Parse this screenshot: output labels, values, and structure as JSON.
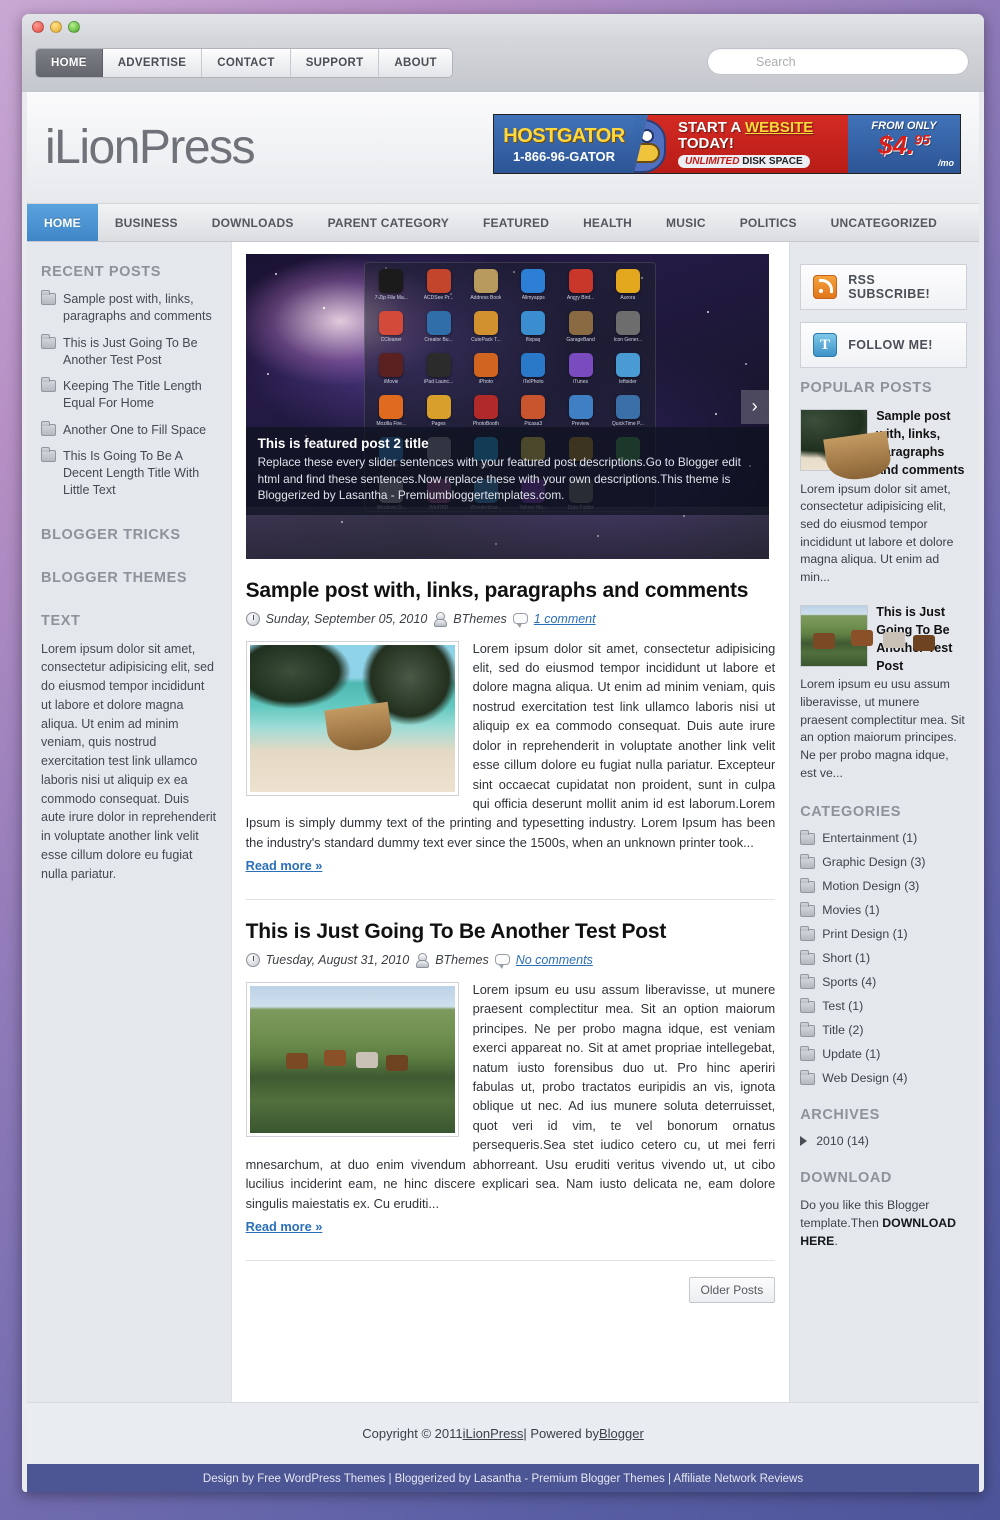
{
  "browser": {
    "dots": [
      "close",
      "minimize",
      "zoom"
    ]
  },
  "topnav": {
    "items": [
      {
        "label": "HOME",
        "active": true
      },
      {
        "label": "ADVERTISE",
        "active": false
      },
      {
        "label": "CONTACT",
        "active": false
      },
      {
        "label": "SUPPORT",
        "active": false
      },
      {
        "label": "ABOUT",
        "active": false
      }
    ]
  },
  "search": {
    "placeholder": "Search",
    "value": ""
  },
  "header": {
    "logo_first": "i",
    "logo_rest": "LionPress",
    "logo_full": "iLionPress"
  },
  "banner": {
    "brand": "HOSTGATOR",
    "phone": "1-866-96-GATOR",
    "headline_pre": "START A ",
    "headline_em": "WEBSITE",
    "headline_post": "TODAY!",
    "subline_em": "UNLIMITED",
    "subline_rest": " DISK SPACE",
    "price_label": "FROM ONLY",
    "price_main": "$4.",
    "price_cents": "95",
    "price_unit": "/mo"
  },
  "mainnav": {
    "items": [
      {
        "label": "HOME",
        "active": true
      },
      {
        "label": "BUSINESS",
        "active": false
      },
      {
        "label": "DOWNLOADS",
        "active": false
      },
      {
        "label": "PARENT CATEGORY",
        "active": false
      },
      {
        "label": "FEATURED",
        "active": false
      },
      {
        "label": "HEALTH",
        "active": false
      },
      {
        "label": "MUSIC",
        "active": false
      },
      {
        "label": "POLITICS",
        "active": false
      },
      {
        "label": "UNCATEGORIZED",
        "active": false
      }
    ]
  },
  "sidebar_left": {
    "recent_posts_title": "RECENT POSTS",
    "recent_posts": [
      "Sample post with, links, paragraphs and comments",
      "This is Just Going To Be Another Test Post",
      "Keeping The Title Length Equal For Home",
      "Another One to Fill Space",
      "This Is Going To Be A Decent Length Title With Little Text"
    ],
    "blogger_tricks_title": "BLOGGER TRICKS",
    "blogger_themes_title": "BLOGGER THEMES",
    "text_title": "TEXT",
    "text_body": "Lorem ipsum dolor sit amet, consectetur adipisicing elit, sed do eiusmod tempor incididunt ut labore et dolore magna aliqua. Ut enim ad minim veniam, quis nostrud exercitation test link ullamco laboris nisi ut aliquip ex ea commodo consequat. Duis aute irure dolor in reprehenderit in voluptate another link velit esse cillum dolore eu fugiat nulla pariatur."
  },
  "slider": {
    "caption_title": "This is featured post 2 title",
    "caption_body": "Replace these every slider sentences with your featured post descriptions.Go to Blogger edit html and find these sentences.Now replace these with your own descriptions.This theme is Bloggerized by Lasantha - Premiumbloggertemplates.com.",
    "next_arrow": "›",
    "apps": [
      {
        "name": "7-Zip File Ma...",
        "color": "#1b1b1b"
      },
      {
        "name": "ACDSee Pr...",
        "color": "#c3452c"
      },
      {
        "name": "Address Book",
        "color": "#b99a5e"
      },
      {
        "name": "Allmyapps",
        "color": "#2c7fd4"
      },
      {
        "name": "Angry Bird...",
        "color": "#c9372b"
      },
      {
        "name": "Aurora",
        "color": "#e4a81f"
      },
      {
        "name": "CCleaner",
        "color": "#d34a3a"
      },
      {
        "name": "Creator Bu...",
        "color": "#2f6ea8"
      },
      {
        "name": "CutePack T...",
        "color": "#d2912f"
      },
      {
        "name": "flixpaq",
        "color": "#3a8ecf"
      },
      {
        "name": "GarageBand",
        "color": "#8a6a42"
      },
      {
        "name": "Icon Gener...",
        "color": "#6d6d6d"
      },
      {
        "name": "iMovie",
        "color": "#5b2020"
      },
      {
        "name": "iPad Launc...",
        "color": "#2b2b2b"
      },
      {
        "name": "iPhoto",
        "color": "#d1641f"
      },
      {
        "name": "iTelPhoto",
        "color": "#2a79c8"
      },
      {
        "name": "iTunes",
        "color": "#7a4bbf"
      },
      {
        "name": "leftsider",
        "color": "#4a9ad4"
      },
      {
        "name": "Mozilla Fire...",
        "color": "#e06b1e"
      },
      {
        "name": "Pages",
        "color": "#d8a02a"
      },
      {
        "name": "PhotoBooth",
        "color": "#b02a2a"
      },
      {
        "name": "Picasa3",
        "color": "#c8552e"
      },
      {
        "name": "Preview",
        "color": "#3f7fc4"
      },
      {
        "name": "QuickTime P...",
        "color": "#3b6fa8"
      },
      {
        "name": "Safari",
        "color": "#2f86cc"
      },
      {
        "name": "Settings",
        "color": "#8d9199"
      },
      {
        "name": "Skype",
        "color": "#22a4e0"
      },
      {
        "name": "Sticky Notes",
        "color": "#e8d14a"
      },
      {
        "name": "Total Imag...",
        "color": "#b58a2a"
      },
      {
        "name": "uTorrent",
        "color": "#3e9c4c"
      },
      {
        "name": "Windows D...",
        "color": "#9aa0a8"
      },
      {
        "name": "WinRAR",
        "color": "#9c4b8a"
      },
      {
        "name": "Wondershar...",
        "color": "#3d8fc8"
      },
      {
        "name": "Yahoo! Me...",
        "color": "#7b3fb5"
      },
      {
        "name": "Data Folder",
        "color": "#6f6f6f"
      }
    ]
  },
  "posts": [
    {
      "title": "Sample post with, links, paragraphs and comments",
      "date": "Sunday, September 05, 2010",
      "author": "BThemes",
      "comments": "1 comment",
      "body": "Lorem ipsum dolor sit amet, consectetur adipisicing elit, sed do eiusmod tempor incididunt ut labore et dolore magna aliqua. Ut enim ad minim veniam, quis nostrud exercitation test link ullamco laboris nisi ut aliquip ex ea commodo consequat. Duis aute irure dolor in reprehenderit in voluptate another link velit esse cillum dolore eu fugiat nulla pariatur. Excepteur sint occaecat cupidatat non proident, sunt in culpa qui officia deserunt mollit anim id est laborum.Lorem Ipsum is simply dummy text of the printing and typesetting industry. Lorem Ipsum has been the industry's standard dummy text ever since the 1500s, when an unknown printer took...",
      "readmore": "Read more »",
      "thumb": "beach-longtail-boat"
    },
    {
      "title": "This is Just Going To Be Another Test Post",
      "date": "Tuesday, August 31, 2010",
      "author": "BThemes",
      "comments": "No comments",
      "body": "Lorem ipsum eu usu assum liberavisse, ut munere praesent complectitur mea. Sit an option maiorum principes. Ne per probo magna idque, est veniam exerci appareat no. Sit at amet propriae intellegebat, natum iusto forensibus duo ut. Pro hinc aperiri fabulas ut, probo tractatos euripidis an vis, ignota oblique ut nec. Ad ius munere soluta deterruisset, quot veri id vim, te vel bonorum ornatus persequeris.Sea stet iudico cetero cu, ut mei ferri mnesarchum, at duo enim vivendum abhorreant. Usu eruditi veritus vivendo ut, ut cibo lucilius inciderint eam, ne hinc discere explicari sea. Nam iusto delicata ne, eam dolore singulis maiestatis ex. Cu eruditi...",
      "readmore": "Read more »",
      "thumb": "horses-field"
    }
  ],
  "pager": {
    "older_posts": "Older Posts"
  },
  "sidebar_right": {
    "rss_label": "RSS SUBSCRIBE!",
    "follow_label": "FOLLOW ME!",
    "popular_title": "POPULAR POSTS",
    "popular_posts": [
      {
        "title": "Sample post with, links, paragraphs and comments",
        "excerpt": "Lorem ipsum dolor sit amet, consectetur adipisicing elit, sed do eiusmod tempor incididunt ut labore et dolore magna aliqua. Ut enim ad min...",
        "thumb": "beach-longtail-boat"
      },
      {
        "title": "This is Just Going To Be Another Test Post",
        "excerpt": "Lorem ipsum eu usu assum liberavisse, ut munere praesent complectitur mea. Sit an option maiorum principes. Ne per probo magna idque, est ve...",
        "thumb": "horses-field"
      }
    ],
    "categories_title": "CATEGORIES",
    "categories": [
      "Entertainment (1)",
      "Graphic Design (3)",
      "Motion Design (3)",
      "Movies (1)",
      "Print Design (1)",
      "Short (1)",
      "Sports (4)",
      "Test (1)",
      "Title (2)",
      "Update (1)",
      "Web Design (4)"
    ],
    "archives_title": "ARCHIVES",
    "archive_entry": "2010 (14)",
    "download_title": "DOWNLOAD",
    "download_text_pre": "Do you like this Blogger template.Then ",
    "download_text_link": "DOWNLOAD HERE",
    "download_text_post": "."
  },
  "footer": {
    "copyright_pre": "Copyright © 2011 ",
    "copyright_site": "iLionPress",
    "copyright_mid": " | Powered by ",
    "copyright_platform": "Blogger",
    "credit": "Design by Free WordPress Themes | Bloggerized by Lasantha - Premium Blogger Themes | Affiliate Network Reviews"
  },
  "colors": {
    "accent_blue": "#3f86c8",
    "link_blue": "#2a6fb8",
    "footer_purple": "#4d5694",
    "rss_orange": "#e0761b",
    "page_bg": "#e4e7ec"
  }
}
